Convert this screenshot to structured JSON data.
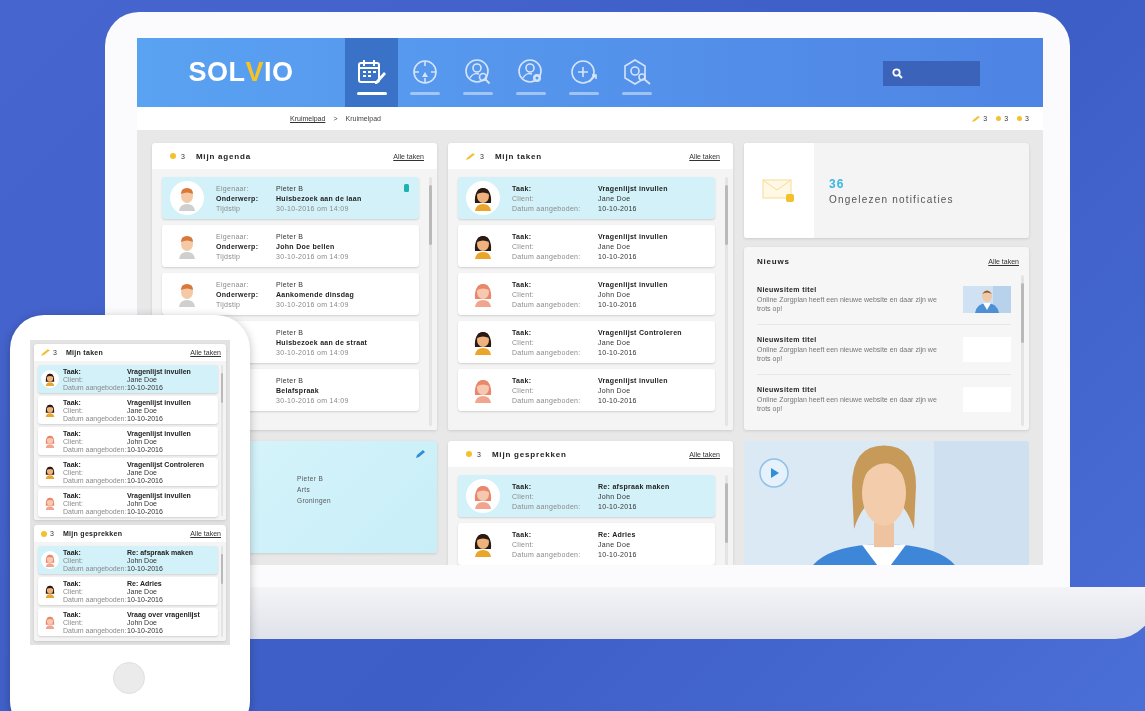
{
  "laptop": {
    "logo": [
      "SOL",
      "V",
      "IO"
    ],
    "nav": [
      {
        "selected": true
      },
      {
        "selected": false
      },
      {
        "selected": false
      },
      {
        "selected": false
      },
      {
        "selected": false
      },
      {
        "selected": false
      }
    ],
    "breadcrumb": {
      "items": [
        "Kruimelpad",
        "Kruimelpad"
      ],
      "separator": ">"
    },
    "counters": [
      {
        "kind": "pencil",
        "count": "3"
      },
      {
        "kind": "dot",
        "count": "3"
      },
      {
        "kind": "dot",
        "count": "3"
      }
    ],
    "agenda": {
      "count": "3",
      "title": "Mijn agenda",
      "link": "Alle taken",
      "items": [
        {
          "selected": true,
          "flagged": true,
          "kind": "man",
          "rows": [
            {
              "label": "Eigenaar:",
              "value": "Pieter B"
            },
            {
              "label": "Onderwerp:",
              "value": "Huisbezoek aan de laan"
            },
            {
              "label": "Tijdstip",
              "value": "30-10-2016 om 14:09"
            }
          ]
        },
        {
          "selected": false,
          "flagged": false,
          "kind": "man",
          "rows": [
            {
              "label": "Eigenaar:",
              "value": "Pieter B"
            },
            {
              "label": "Onderwerp:",
              "value": "John Doe bellen"
            },
            {
              "label": "Tijdstip",
              "value": "30-10-2016 om 14:09"
            }
          ]
        },
        {
          "selected": false,
          "flagged": false,
          "kind": "man",
          "rows": [
            {
              "label": "Eigenaar:",
              "value": "Pieter B"
            },
            {
              "label": "Onderwerp:",
              "value": "Aankomende dinsdag"
            },
            {
              "label": "Tijdstip",
              "value": "30-10-2016 om 14:09"
            }
          ]
        },
        {
          "selected": false,
          "flagged": false,
          "rows": [
            {
              "value": "Pieter B"
            },
            {
              "value": "Huisbezoek aan de straat"
            },
            {
              "value": "30-10-2016 om 14:09"
            }
          ]
        },
        {
          "selected": false,
          "flagged": false,
          "rows": [
            {
              "value": "Pieter B"
            },
            {
              "value": "Belafspraak"
            },
            {
              "value": "30-10-2016 om 14:09"
            }
          ]
        }
      ]
    },
    "tasks": {
      "count": "3",
      "title": "Mijn taken",
      "link": "Alle taken",
      "items": [
        {
          "selected": true,
          "kind": "dark",
          "rows": [
            {
              "label": "Taak:",
              "value": "Vragenlijst invullen"
            },
            {
              "label": "Client:",
              "value": "Jane Doe"
            },
            {
              "label": "Datum aangeboden:",
              "value": "10-10-2016"
            }
          ]
        },
        {
          "selected": false,
          "kind": "dark",
          "rows": [
            {
              "label": "Taak:",
              "value": "Vragenlijst invullen"
            },
            {
              "label": "Client:",
              "value": "Jane Doe"
            },
            {
              "label": "Datum aangeboden:",
              "value": "10-10-2016"
            }
          ]
        },
        {
          "selected": false,
          "kind": "red",
          "rows": [
            {
              "label": "Taak:",
              "value": "Vragenlijst invullen"
            },
            {
              "label": "Client:",
              "value": "John Doe"
            },
            {
              "label": "Datum aangeboden:",
              "value": "10-10-2016"
            }
          ]
        },
        {
          "selected": false,
          "kind": "dark",
          "rows": [
            {
              "label": "Taak:",
              "value": "Vragenlijst Controleren"
            },
            {
              "label": "Client:",
              "value": "Jane Doe"
            },
            {
              "label": "Datum aangeboden:",
              "value": "10-10-2016"
            }
          ]
        },
        {
          "selected": false,
          "kind": "red",
          "rows": [
            {
              "label": "Taak:",
              "value": "Vragenlijst invullen"
            },
            {
              "label": "Client:",
              "value": "John Doe"
            },
            {
              "label": "Datum aangeboden:",
              "value": "10-10-2016"
            }
          ]
        }
      ]
    },
    "notifications": {
      "count": "36",
      "label": "Ongelezen notificaties"
    },
    "news": {
      "title": "Nieuws",
      "link": "Alle taken",
      "items": [
        {
          "title": "Nieuwsitem titel",
          "text": "Online Zorgplan heeft een nieuwe website en daar zijn we trots op!",
          "kind": "picture"
        },
        {
          "title": "Nieuwsitem titel",
          "text": "Online Zorgplan heeft een nieuwe website en daar zijn we trots op!",
          "kind": "empty"
        },
        {
          "title": "Nieuwsitem titel",
          "text": "Online Zorgplan heeft een nieuwe website en daar zijn we trots op!",
          "kind": "empty"
        }
      ]
    },
    "profile": {
      "lines": [
        "Pieter B",
        "Arts",
        "Groningen"
      ]
    },
    "conversations": {
      "count": "3",
      "title": "Mijn gesprekken",
      "link": "Alle taken",
      "items": [
        {
          "selected": true,
          "kind": "red",
          "rows": [
            {
              "label": "Taak:",
              "value": "Re: afspraak maken"
            },
            {
              "label": "Client:",
              "value": "John Doe"
            },
            {
              "label": "Datum aangeboden:",
              "value": "10-10-2016"
            }
          ]
        },
        {
          "selected": false,
          "kind": "dark",
          "rows": [
            {
              "label": "Taak:",
              "value": "Re: Adries"
            },
            {
              "label": "Client:",
              "value": "Jane Doe"
            },
            {
              "label": "Datum aangeboden:",
              "value": "10-10-2016"
            }
          ]
        }
      ]
    }
  },
  "phone": {
    "panels": [
      {
        "count": "3",
        "title": "Mijn taken",
        "link": "Alle taken",
        "items": [
          {
            "selected": true,
            "kind": "dark",
            "rows": [
              {
                "label": "Taak:",
                "value": "Vragenlijst invullen"
              },
              {
                "label": "Client:",
                "value": "Jane Doe"
              },
              {
                "label": "Datum aangeboden:",
                "value": "10-10-2016"
              }
            ]
          },
          {
            "selected": false,
            "kind": "dark",
            "rows": [
              {
                "label": "Taak:",
                "value": "Vragenlijst invullen"
              },
              {
                "label": "Client:",
                "value": "Jane Doe"
              },
              {
                "label": "Datum aangeboden:",
                "value": "10-10-2016"
              }
            ]
          },
          {
            "selected": false,
            "kind": "red",
            "rows": [
              {
                "label": "Taak:",
                "value": "Vragenlijst invullen"
              },
              {
                "label": "Client:",
                "value": "John Doe"
              },
              {
                "label": "Datum aangeboden:",
                "value": "10-10-2016"
              }
            ]
          },
          {
            "selected": false,
            "kind": "dark",
            "rows": [
              {
                "label": "Taak:",
                "value": "Vragenlijst Controleren"
              },
              {
                "label": "Client:",
                "value": "Jane Doe"
              },
              {
                "label": "Datum aangeboden:",
                "value": "10-10-2016"
              }
            ]
          },
          {
            "selected": false,
            "kind": "red",
            "rows": [
              {
                "label": "Taak:",
                "value": "Vragenlijst invullen"
              },
              {
                "label": "Client:",
                "value": "John Doe"
              },
              {
                "label": "Datum aangeboden:",
                "value": "10-10-2016"
              }
            ]
          }
        ]
      },
      {
        "count": "3",
        "title": "Mijn gesprekken",
        "link": "Alle taken",
        "items": [
          {
            "selected": true,
            "kind": "red",
            "rows": [
              {
                "label": "Taak:",
                "value": "Re: afspraak maken"
              },
              {
                "label": "Client:",
                "value": "John Doe"
              },
              {
                "label": "Datum aangeboden:",
                "value": "10-10-2016"
              }
            ]
          },
          {
            "selected": false,
            "kind": "dark",
            "rows": [
              {
                "label": "Taak:",
                "value": "Re: Adries"
              },
              {
                "label": "Client:",
                "value": "Jane Doe"
              },
              {
                "label": "Datum aangeboden:",
                "value": "10-10-2016"
              }
            ]
          },
          {
            "selected": false,
            "kind": "red",
            "rows": [
              {
                "label": "Taak:",
                "value": "Vraag over vragenlijst"
              },
              {
                "label": "Client:",
                "value": "John Doe"
              },
              {
                "label": "Datum aangeboden:",
                "value": "10-10-2016"
              }
            ]
          }
        ]
      }
    ]
  }
}
